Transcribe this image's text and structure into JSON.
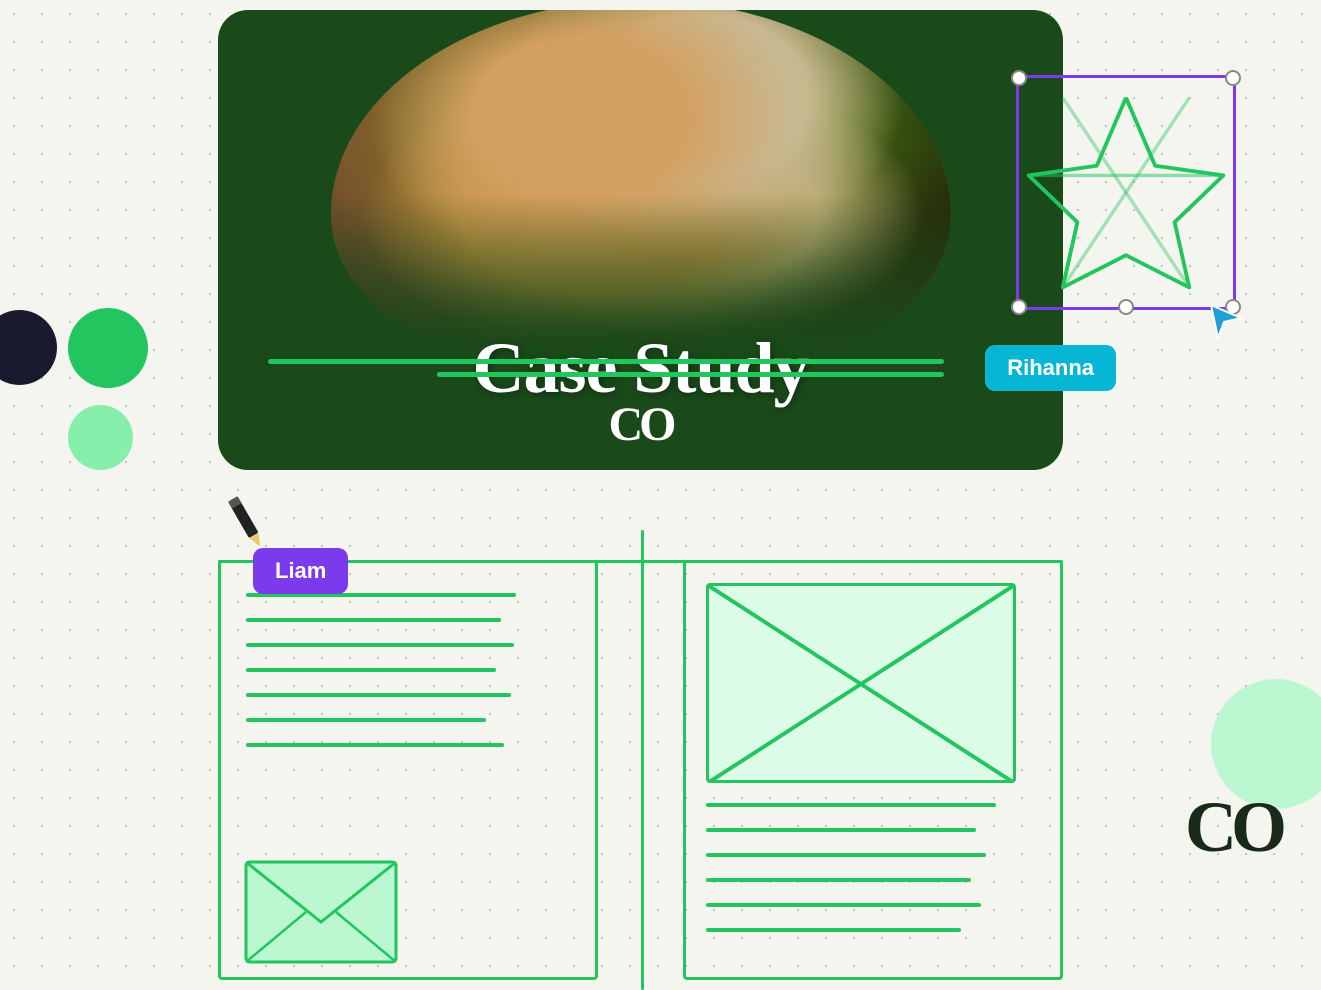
{
  "page": {
    "background_color": "#f5f5f0"
  },
  "case_study_card": {
    "title": "Case Study",
    "logo_text": "CO",
    "background_color": "#1a4a1a"
  },
  "tags": {
    "rihanna": {
      "label": "Rihanna",
      "background": "#06b6d4"
    },
    "liam": {
      "label": "Liam",
      "background": "#7c3aed"
    }
  },
  "bottom_logo": "CO",
  "selection_box": {
    "border_color": "#7c3aed"
  }
}
